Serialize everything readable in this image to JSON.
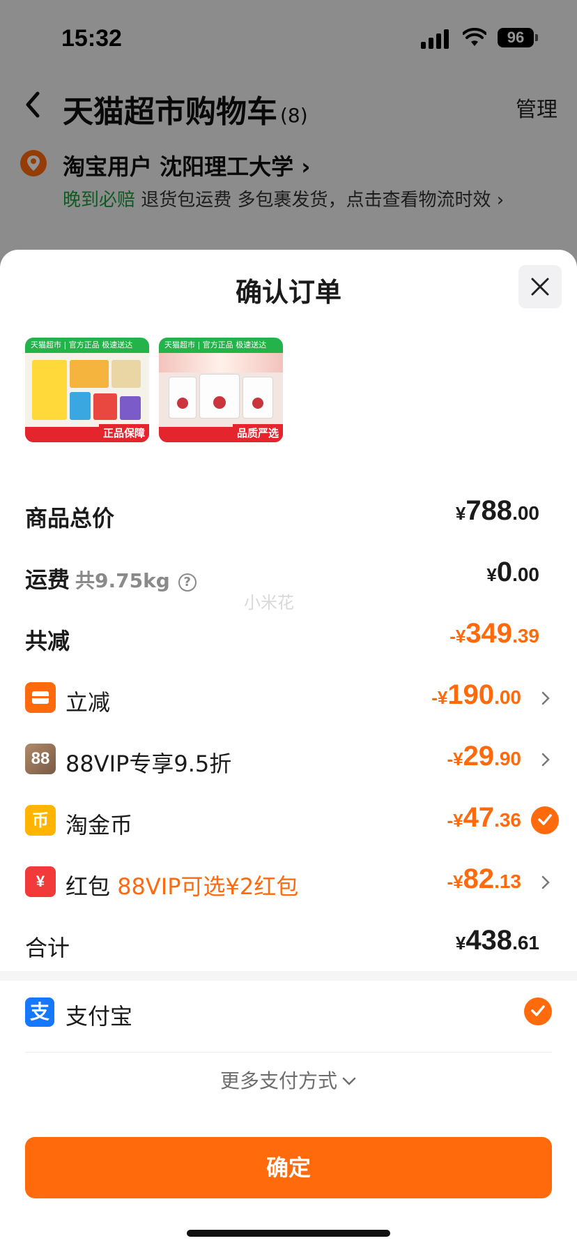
{
  "status_bar": {
    "time": "15:32",
    "battery": "96"
  },
  "cart": {
    "title": "天猫超市购物车",
    "count": "(8)",
    "manage_label": "管理",
    "address": "淘宝用户  沈阳理工大学",
    "address_arrow": "›",
    "logistics_highlight": "晚到必赔",
    "logistics_text": " 退货包运费  多包裹发货，点击查看物流时效 ›"
  },
  "sheet": {
    "title": "确认订单",
    "products": [
      {
        "banner": "天猫超市 | 官方正品 极速送达",
        "foot": "正品保障"
      },
      {
        "banner": "天猫超市 | 官方正品 极速送达",
        "foot": "品质严选"
      }
    ],
    "watermark": "小米花",
    "rows": {
      "subtotal": {
        "label": "商品总价",
        "cur": "¥",
        "int": "788",
        "dec": ".00"
      },
      "shipping": {
        "label": "运费",
        "sub": "共9.75kg",
        "help": "?",
        "cur": "¥",
        "int": "0",
        "dec": ".00"
      },
      "total_discount": {
        "label": "共减",
        "cur": "-¥",
        "int": "349",
        "dec": ".39"
      },
      "instant_discount": {
        "label": "立减",
        "cur": "-¥",
        "int": "190",
        "dec": ".00"
      },
      "vip_discount": {
        "label": "88VIP专享9.5折",
        "icon_text": "88",
        "cur": "-¥",
        "int": "29",
        "dec": ".90"
      },
      "tao_coins": {
        "label": "淘金币",
        "icon_text": "币",
        "cur": "-¥",
        "int": "47",
        "dec": ".36"
      },
      "red_packet": {
        "label": "红包",
        "note": "88VIP可选¥2红包",
        "icon_text": "¥",
        "cur": "-¥",
        "int": "82",
        "dec": ".13"
      },
      "total": {
        "label": "合计",
        "cur": "¥",
        "int": "438",
        "dec": ".61"
      }
    },
    "payment": {
      "method": "支付宝",
      "icon_text": "支",
      "more_label": "更多支付方式"
    },
    "confirm_label": "确定"
  },
  "colors": {
    "accent": "#ff6a0d",
    "green": "#1a9c3c",
    "alipay": "#1677ff"
  }
}
